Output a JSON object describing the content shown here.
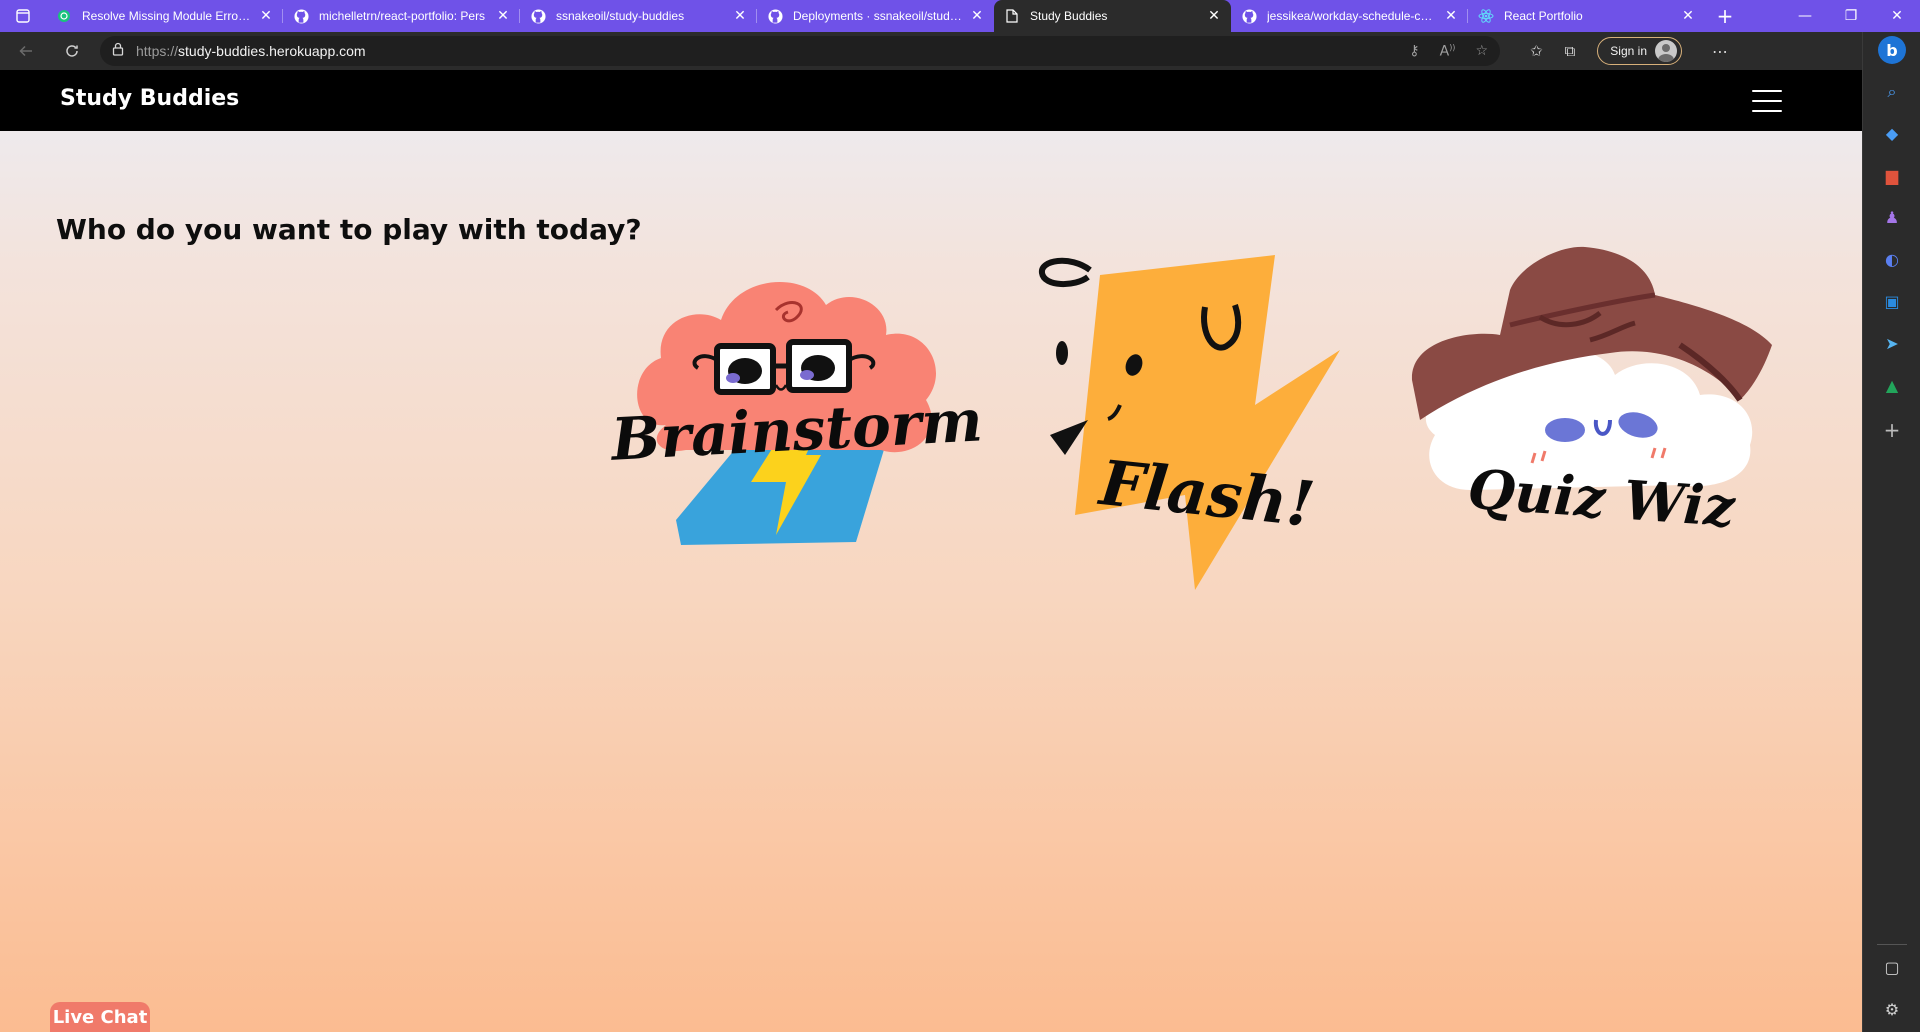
{
  "browser": {
    "tabs": [
      {
        "title": "Resolve Missing Module Errors.",
        "icon": "openai-icon",
        "active": false
      },
      {
        "title": "michelletrn/react-portfolio: Pers",
        "icon": "github-icon",
        "active": false
      },
      {
        "title": "ssnakeoil/study-buddies",
        "icon": "github-icon",
        "active": false
      },
      {
        "title": "Deployments · ssnakeoil/study-b",
        "icon": "github-icon",
        "active": false
      },
      {
        "title": "Study Buddies",
        "icon": "page-icon",
        "active": true
      },
      {
        "title": "jessikea/workday-schedule-chal",
        "icon": "github-icon",
        "active": false
      },
      {
        "title": "React Portfolio",
        "icon": "react-icon",
        "active": false
      }
    ],
    "url_protocol": "https://",
    "url_host": "study-buddies.herokuapp.com",
    "sign_in_label": "Sign in",
    "accent_color": "#6f52e8"
  },
  "site": {
    "brand": "Study Buddies",
    "headline": "Who do you want to play with today?",
    "characters": [
      {
        "name": "Brainstorm",
        "color": "#f98374"
      },
      {
        "name": "Flash!",
        "color": "#fdae3b"
      },
      {
        "name": "Quiz Wiz",
        "color": "#8a4a44"
      }
    ],
    "live_chat": "Live Chat",
    "live_chat_color": "#f07a6a"
  }
}
